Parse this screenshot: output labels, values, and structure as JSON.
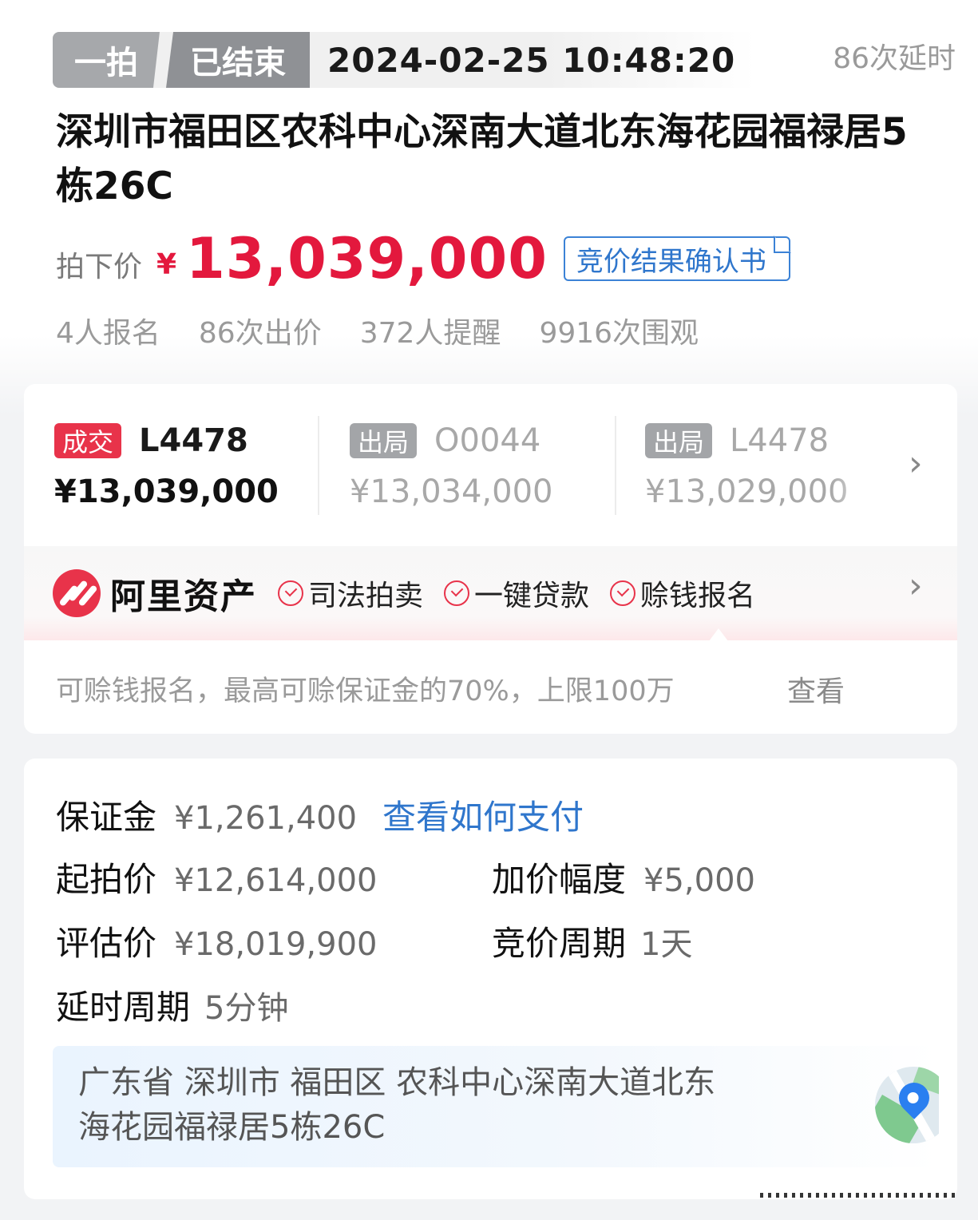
{
  "header": {
    "auction_round": "一拍",
    "status": "已结束",
    "end_time": "2024-02-25 10:48:20",
    "delay_count": "86次延时"
  },
  "title": "深圳市福田区农科中心深南大道北东海花园福禄居5栋26C",
  "price": {
    "label": "拍下价",
    "currency": "¥",
    "value": "13,039,000",
    "confirm_button": "竞价结果确认书"
  },
  "stats": {
    "signups": "4人报名",
    "bids": "86次出价",
    "reminders": "372人提醒",
    "views": "9916次围观"
  },
  "bids": [
    {
      "badge": "成交",
      "bidder": "L4478",
      "amount": "¥13,039,000",
      "state": "won"
    },
    {
      "badge": "出局",
      "bidder": "O0044",
      "amount": "¥13,034,000",
      "state": "out"
    },
    {
      "badge": "出局",
      "bidder": "L4478",
      "amount": "¥13,029,000",
      "state": "out"
    }
  ],
  "ali": {
    "brand": "阿里资产",
    "features": [
      "司法拍卖",
      "一键贷款",
      "赊钱报名"
    ],
    "tip": "可赊钱报名，最高可赊保证金的70%，上限100万",
    "view_link": "查看"
  },
  "details": {
    "deposit_label": "保证金",
    "deposit_value": "¥1,261,400",
    "deposit_link": "查看如何支付",
    "start_price_label": "起拍价",
    "start_price_value": "¥12,614,000",
    "increment_label": "加价幅度",
    "increment_value": "¥5,000",
    "appraisal_label": "评估价",
    "appraisal_value": "¥18,019,900",
    "cycle_label": "竞价周期",
    "cycle_value": "1天",
    "delay_label": "延时周期",
    "delay_value": "5分钟"
  },
  "address": {
    "text_line1": "广东省 深圳市 福田区 农科中心深南大道北东",
    "text_line2": "海花园福禄居5栋26C"
  },
  "colors": {
    "accent_red": "#e3183d",
    "link_blue": "#2f76cc",
    "badge_grey": "#a3a5a8"
  }
}
